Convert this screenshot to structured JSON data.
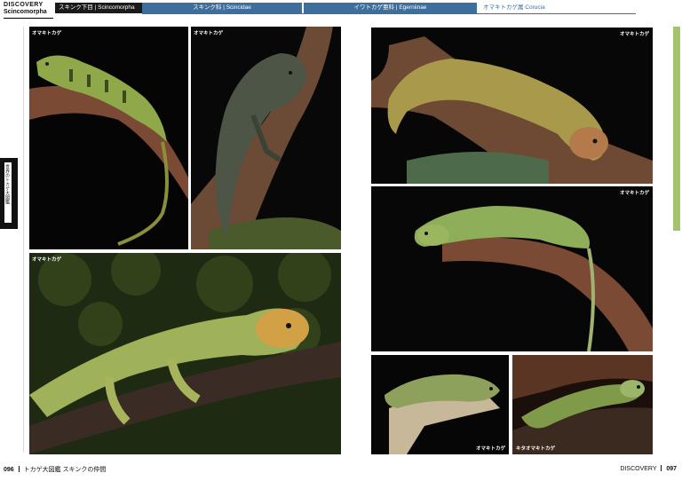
{
  "header": {
    "brand_top": "DISCOVERY",
    "brand_bottom": "Scincomorpha",
    "tabs": [
      "スキンク下目 | Scincomorpha",
      "スキンク科 | Scincidae",
      "イワトカゲ亜科 | Egerniinae",
      "オマキトカゲ属 Corucia"
    ]
  },
  "side_index": {
    "label": "世界のトカゲ大図鑑"
  },
  "photos": [
    {
      "caption": "オマキトカゲ"
    },
    {
      "caption": "オマキトカゲ"
    },
    {
      "caption": "オマキトカゲ"
    },
    {
      "caption": "オマキトカゲ"
    },
    {
      "caption": "オマキトカゲ"
    },
    {
      "caption": "オマキトカゲ"
    },
    {
      "caption": "キタオマキトカゲ"
    }
  ],
  "footer": {
    "left_page": "096",
    "left_title": "トカゲ大図鑑 スキンクの仲間",
    "right_brand": "DISCOVERY",
    "right_page": "097"
  },
  "colors": {
    "header_blue": "#3d6e9c",
    "side_green": "#a3c46d",
    "lizard_green": "#8fa84a",
    "branch_brown": "#7a4a34"
  }
}
